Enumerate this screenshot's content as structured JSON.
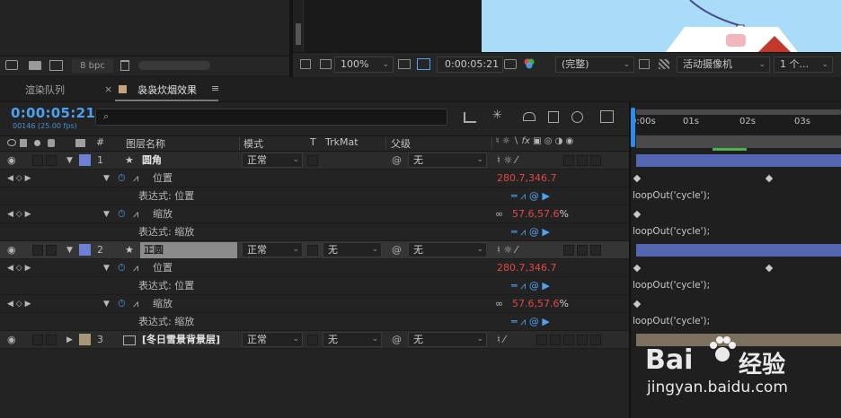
{
  "project_panel": {
    "bpc": "8 bpc"
  },
  "viewer_toolbar": {
    "zoom": "100%",
    "timecode": "0:00:05:21",
    "resolution": "(完整)",
    "camera": "活动摄像机",
    "views": "1 个..."
  },
  "tabs": {
    "render_queue": "渲染队列",
    "comp": "袅袅炊烟效果"
  },
  "comp": {
    "timecode": "0:00:05:21",
    "frame_info": "00146 (25.00 fps)",
    "search_placeholder": ""
  },
  "columns": {
    "num": "#",
    "name": "图层名称",
    "mode": "模式",
    "t": "T",
    "trkmat": "TrkMat",
    "parent": "父级"
  },
  "ruler": [
    "0:00s",
    "01s",
    "02s",
    "03s"
  ],
  "layers": [
    {
      "num": "1",
      "name": "圆角",
      "mode": "正常",
      "trkmat": "",
      "parent": "无",
      "label_color": "#6e7fd6",
      "props": [
        {
          "name": "位置",
          "value_a": "280.7",
          "value_b": "346.7",
          "suffix": "",
          "expr_label": "表达式: 位置",
          "expr": "loopOut('cycle');"
        },
        {
          "name": "缩放",
          "value_a": "57.6",
          "value_b": "57.6",
          "suffix": "%",
          "expr_label": "表达式: 缩放",
          "expr": "loopOut('cycle');"
        }
      ]
    },
    {
      "num": "2",
      "name": "正圆",
      "mode": "正常",
      "trkmat": "无",
      "parent": "无",
      "label_color": "#6e7fd6",
      "props": [
        {
          "name": "位置",
          "value_a": "280.7",
          "value_b": "346.7",
          "suffix": "",
          "expr_label": "表达式: 位置",
          "expr": "loopOut('cycle');"
        },
        {
          "name": "缩放",
          "value_a": "57.6",
          "value_b": "57.6",
          "suffix": "%",
          "expr_label": "表达式: 缩放",
          "expr": "loopOut('cycle');"
        }
      ]
    },
    {
      "num": "3",
      "name": "[冬日雪景背景层]",
      "mode": "正常",
      "trkmat": "无",
      "parent": "无",
      "label_color": "#a89679"
    }
  ],
  "watermark": {
    "brand_a": "Bai",
    "brand_b": "经验",
    "url": "jingyan.baidu.com"
  }
}
